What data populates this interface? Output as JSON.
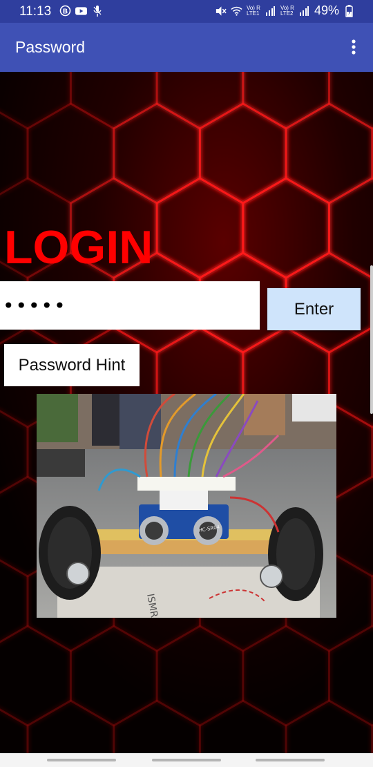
{
  "status_bar": {
    "time": "11:13",
    "battery": "49%",
    "sim1": "LTE1",
    "sim2": "LTE2",
    "volte": "Vo) R"
  },
  "app_bar": {
    "title": "Password",
    "menu_icon": "more-vert-icon"
  },
  "login": {
    "title": "LOGIN",
    "password_value": "•••••",
    "enter_label": "Enter",
    "hint_label": "Password Hint"
  },
  "image": {
    "icon": "robot-car-photo",
    "sensor_text": "HC-SR04",
    "sign_text": "ISMRIT"
  },
  "colors": {
    "status_bar": "#2f3e9e",
    "app_bar": "#3f51b5",
    "login_title": "#ff0000",
    "enter_button": "#cfe4fb",
    "background": "#050000",
    "hex_glow": "#ff1a1a"
  }
}
